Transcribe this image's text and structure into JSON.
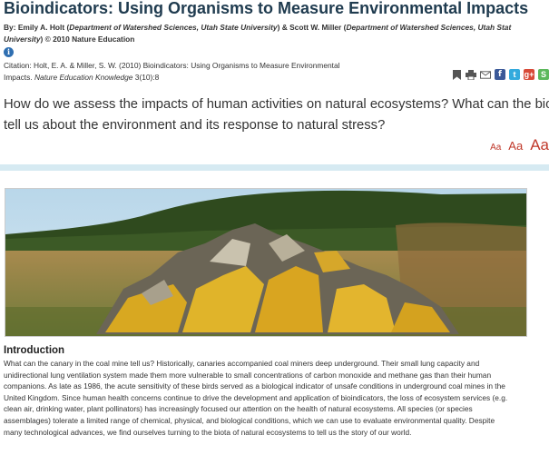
{
  "article": {
    "title": "Bioindicators: Using Organisms to Measure Environmental Impacts",
    "byline_line1_prefix": "By: Emily A. Holt (",
    "byline_dept1": "Department of Watershed Sciences, Utah State University",
    "byline_mid": ") & Scott W. Miller (",
    "byline_dept2": "Department of Watershed Sciences, Utah Stat",
    "byline_line2_italic": "University",
    "byline_line2_rest": ") © 2010 Nature Education",
    "citation_line1": "Citation: Holt, E. A. & Miller, S. W. (2010) Bioindicators: Using Organisms to Measure Environmental",
    "citation_line2_prefix": "Impacts. ",
    "citation_line2_journal": "Nature Education Knowledge",
    "citation_line2_rest": " 3(10):8",
    "lead_line1": "How do we assess the impacts of human activities on natural ecosystems? What can the bio",
    "lead_line2": "tell us about the environment and its response to natural stress?",
    "text_size": {
      "small": "Aa",
      "medium": "Aa",
      "large": "Aa"
    },
    "intro_heading": "Introduction",
    "intro_lines": [
      "What can the canary in the coal mine tell us? Historically, canaries accompanied coal miners deep underground. Their small lung capacity and",
      "unidirectional lung ventilation system made them more vulnerable to small concentrations of carbon monoxide and methane gas than their human",
      "companions. As late as 1986, the acute sensitivity of these birds served as a biological indicator of unsafe conditions in underground coal mines in the",
      "United Kingdom. Since human health concerns continue to drive the development and application of bioindicators, the loss of ecosystem services (e.g.",
      "clean air, drinking water, plant pollinators) has increasingly focused our attention on the health of natural ecosystems. All species (or species",
      "assemblages) tolerate a limited range of chemical, physical, and biological conditions, which we can use to evaluate environmental quality. Despite",
      "many technological advances, we find ourselves turning to the biota of natural ecosystems to tell us the story of our world."
    ]
  },
  "toolbar": {
    "icons": [
      "bookmark-icon",
      "print-icon",
      "email-icon",
      "facebook-icon",
      "twitter-icon",
      "google-plus-icon",
      "stumbleupon-icon"
    ],
    "fb": "f",
    "tw": "t",
    "gp": "g+",
    "su": "S"
  },
  "colors": {
    "title": "#1f3b4f",
    "accent": "#c0392b",
    "rule": "#d6eaf2"
  }
}
